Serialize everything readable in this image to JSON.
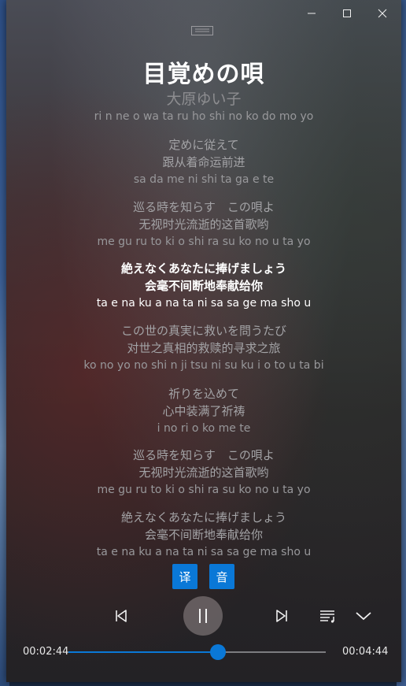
{
  "window": {
    "controls": {
      "minimize": "minimize-icon",
      "maximize": "maximize-icon",
      "close": "close-icon"
    }
  },
  "song": {
    "title": "目覚めの唄",
    "artist": "大原ゆい子",
    "title_romaji": "ri n ne o wa ta ru   ho shi no ko do mo yo"
  },
  "lyrics": [
    {
      "jp": "定めに従えて",
      "cn": "跟从着命运前进",
      "romaji": "sa da me ni shi ta ga e te",
      "active": false
    },
    {
      "jp": "巡る時を知らす　この唄よ",
      "cn": "无视时光流逝的这首歌哟",
      "romaji": "me gu ru to ki o shi ra su   ko no u ta yo",
      "active": false
    },
    {
      "jp": "絶えなくあなたに捧げましょう",
      "cn": "会毫不间断地奉献给你",
      "romaji": "ta e na ku a na ta ni sa sa ge ma sho u",
      "active": true
    },
    {
      "jp": "この世の真実に救いを問うたび",
      "cn": "对世之真相的救赎的寻求之旅",
      "romaji": "ko no yo no shi n ji tsu ni su ku i o to u ta bi",
      "active": false
    },
    {
      "jp": "祈りを込めて",
      "cn": "心中装满了祈祷",
      "romaji": "i no ri o ko me te",
      "active": false
    },
    {
      "jp": "巡る時を知らす　この唄よ",
      "cn": "无视时光流逝的这首歌哟",
      "romaji": "me gu ru to ki o shi ra su   ko no u ta yo",
      "active": false
    },
    {
      "jp": "絶えなくあなたに捧げましょう",
      "cn": "会毫不间断地奉献给你",
      "romaji": "ta e na ku a na ta ni sa sa ge ma sho u",
      "active": false
    }
  ],
  "toggles": {
    "translation_label": "译",
    "romaji_label": "音"
  },
  "player": {
    "current_time": "00:02:44",
    "total_time": "00:04:44",
    "progress": 0.58,
    "icons": {
      "previous": "previous-track-icon",
      "pause": "pause-icon",
      "next": "next-track-icon",
      "playlist": "playlist-icon",
      "collapse": "chevron-down-icon"
    }
  },
  "colors": {
    "accent": "#0a78d7"
  }
}
